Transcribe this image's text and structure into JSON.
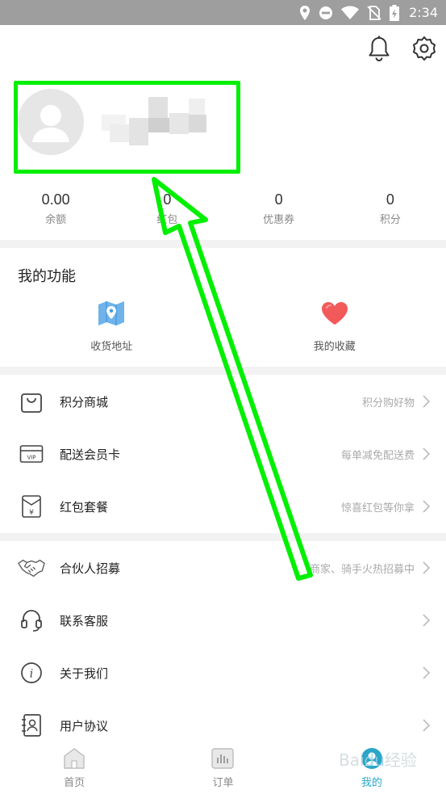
{
  "status_bar": {
    "time": "2:34",
    "icons": [
      "location-icon",
      "do-not-disturb-icon",
      "wifi-icon",
      "no-sim-icon",
      "battery-charging-icon"
    ]
  },
  "top_actions": {
    "icons": [
      "bell-icon",
      "settings-gear-icon"
    ]
  },
  "stats": [
    {
      "value": "0.00",
      "label": "余额"
    },
    {
      "value": "0",
      "label": "红包"
    },
    {
      "value": "0",
      "label": "优惠券"
    },
    {
      "value": "0",
      "label": "积分"
    }
  ],
  "my_functions": {
    "title": "我的功能",
    "items": [
      {
        "label": "收货地址",
        "icon": "map-pin-icon"
      },
      {
        "label": "我的收藏",
        "icon": "heart-icon"
      }
    ]
  },
  "menu_group_1": [
    {
      "label": "积分商城",
      "hint": "积分购好物",
      "icon": "shopping-bag-icon"
    },
    {
      "label": "配送会员卡",
      "hint": "每单减免配送费",
      "icon": "vip-card-icon"
    },
    {
      "label": "红包套餐",
      "hint": "惊喜红包等你拿",
      "icon": "red-envelope-icon"
    }
  ],
  "menu_group_2": [
    {
      "label": "合伙人招募",
      "hint": "商家、骑手火热招募中",
      "icon": "handshake-icon"
    },
    {
      "label": "联系客服",
      "hint": "",
      "icon": "headset-icon"
    },
    {
      "label": "关于我们",
      "hint": "",
      "icon": "info-icon"
    },
    {
      "label": "用户协议",
      "hint": "",
      "icon": "contact-book-icon"
    }
  ],
  "tabbar": [
    {
      "label": "首页",
      "icon": "home-icon"
    },
    {
      "label": "订单",
      "icon": "orders-chart-icon"
    },
    {
      "label": "我的",
      "icon": "profile-icon",
      "active": true
    }
  ],
  "colors": {
    "annotation_green": "#00f000",
    "accent_blue": "#2aa6c8",
    "heart_red": "#f25a5a",
    "map_blue": "#4a9de0"
  }
}
